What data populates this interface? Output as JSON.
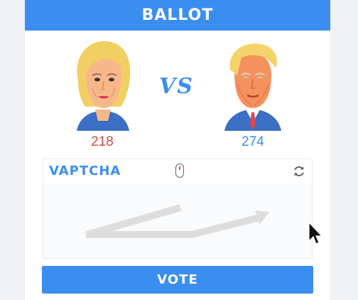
{
  "header": {
    "title": "BALLOT"
  },
  "candidates": [
    {
      "name": "candidate-left",
      "count": "218",
      "color": "#e04747"
    },
    {
      "name": "candidate-right",
      "count": "274",
      "color": "#3b8ef0"
    }
  ],
  "vs_label": "VS",
  "captcha": {
    "logo": "VAPTCHA",
    "icons": [
      "mouse-icon",
      "refresh-icon"
    ],
    "hint_gesture": "trace-path-arrow"
  },
  "vote_button": {
    "label": "VOTE"
  },
  "colors": {
    "accent": "#3b8ef0",
    "red": "#e04747",
    "track": "#dddddd"
  }
}
